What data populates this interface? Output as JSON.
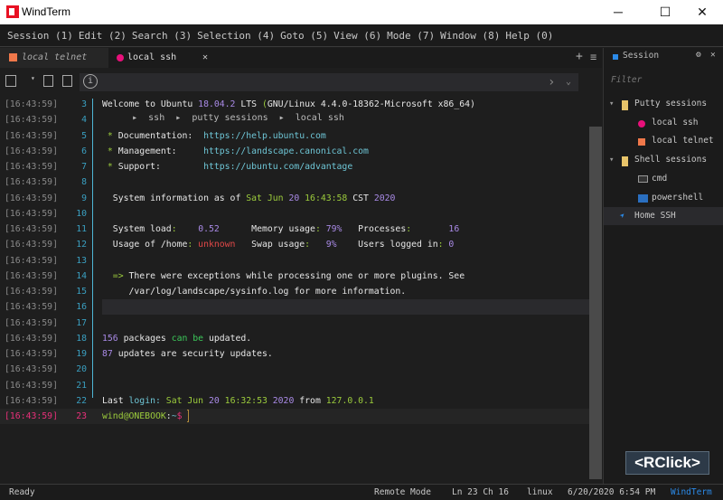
{
  "window": {
    "title": "WindTerm",
    "minimize": "─",
    "maximize": "☐",
    "close": "✕"
  },
  "menu": [
    "Session (1)",
    "Edit (2)",
    "Search (3)",
    "Selection (4)",
    "Goto (5)",
    "View (6)",
    "Mode (7)",
    "Window (8)",
    "Help (0)"
  ],
  "tabs": [
    {
      "label": "local telnet",
      "color": "#f0784a"
    },
    {
      "label": "local ssh",
      "color": "#e8107a"
    }
  ],
  "tab_close": "✕",
  "tab_add": "+",
  "tab_menu": "≡",
  "breadcrumb": "▸  ssh  ▸  putty sessions  ▸  local ssh",
  "colors": {
    "w": "#e6e6e6",
    "p": "#a98ae6",
    "g": "#9ccc3c",
    "c": "#6ec5d5",
    "r": "#e04848",
    "G": "#3cc85a",
    "d": "#b0b0b0",
    "pink": "#e8307a"
  },
  "terminal": {
    "timestamp": "[16:43:59]",
    "lines": [
      {
        "n": "3",
        "s": [
          [
            "Welcome to Ubuntu ",
            "w"
          ],
          [
            "18.04.2",
            "p"
          ],
          [
            " LTS ",
            "w"
          ],
          [
            "(",
            "g"
          ],
          [
            "GNU/Linux 4.4.0-18362-Microsoft x86_64)",
            "w"
          ]
        ]
      },
      {
        "n": "4",
        "s": []
      },
      {
        "n": "5",
        "s": [
          [
            " * ",
            "g"
          ],
          [
            "Documentation:  ",
            "w"
          ],
          [
            "https://help.ubuntu.com",
            "c"
          ]
        ]
      },
      {
        "n": "6",
        "s": [
          [
            " * ",
            "g"
          ],
          [
            "Management:     ",
            "w"
          ],
          [
            "https://landscape.canonical.com",
            "c"
          ]
        ]
      },
      {
        "n": "7",
        "s": [
          [
            " * ",
            "g"
          ],
          [
            "Support:        ",
            "w"
          ],
          [
            "https://ubuntu.com/advantage",
            "c"
          ]
        ]
      },
      {
        "n": "8",
        "s": []
      },
      {
        "n": "9",
        "s": [
          [
            "  System information as of ",
            "w"
          ],
          [
            "Sat Jun ",
            "g"
          ],
          [
            "20",
            "p"
          ],
          [
            " 16:43:58 ",
            "g"
          ],
          [
            "CST ",
            "w"
          ],
          [
            "2020",
            "p"
          ]
        ]
      },
      {
        "n": "10",
        "s": []
      },
      {
        "n": "11",
        "s": [
          [
            "  System load",
            "w"
          ],
          [
            ":    ",
            "g"
          ],
          [
            "0.52",
            "p"
          ],
          [
            "      Memory usage",
            "w"
          ],
          [
            ": ",
            "g"
          ],
          [
            "79%",
            "p"
          ],
          [
            "   Processes",
            "w"
          ],
          [
            ":       ",
            "g"
          ],
          [
            "16",
            "p"
          ]
        ]
      },
      {
        "n": "12",
        "s": [
          [
            "  Usage of /home",
            "w"
          ],
          [
            ": ",
            "g"
          ],
          [
            "unknown",
            "r"
          ],
          [
            "   Swap usage",
            "w"
          ],
          [
            ":   ",
            "g"
          ],
          [
            "9%",
            "p"
          ],
          [
            "    Users logged in",
            "w"
          ],
          [
            ": ",
            "g"
          ],
          [
            "0",
            "p"
          ]
        ]
      },
      {
        "n": "13",
        "s": []
      },
      {
        "n": "14",
        "s": [
          [
            "  => ",
            "g"
          ],
          [
            "There were exceptions while processing one or more plugins. See",
            "w"
          ]
        ]
      },
      {
        "n": "15",
        "s": [
          [
            "     /var/log/landscape/sysinfo.log for more information.",
            "w"
          ]
        ]
      },
      {
        "n": "16",
        "s": []
      },
      {
        "n": "17",
        "s": []
      },
      {
        "n": "18",
        "s": [
          [
            "156",
            "p"
          ],
          [
            " packages ",
            "w"
          ],
          [
            "can be",
            "G"
          ],
          [
            " updated.",
            "w"
          ]
        ]
      },
      {
        "n": "19",
        "s": [
          [
            "87",
            "p"
          ],
          [
            " updates are security updates.",
            "w"
          ]
        ]
      },
      {
        "n": "20",
        "s": []
      },
      {
        "n": "21",
        "s": []
      },
      {
        "n": "22",
        "s": [
          [
            "Last ",
            "w"
          ],
          [
            "login: ",
            "c"
          ],
          [
            "Sat Jun ",
            "g"
          ],
          [
            "20",
            "p"
          ],
          [
            " 16:32:53 ",
            "g"
          ],
          [
            "2020",
            "p"
          ],
          [
            " from ",
            "w"
          ],
          [
            "127.0.0.1",
            "g"
          ]
        ]
      },
      {
        "n": "23",
        "s": [
          [
            "wind@ONEBOOK",
            "g"
          ],
          [
            ":",
            "w"
          ],
          [
            "~",
            "c"
          ],
          [
            "$",
            "pink"
          ],
          [
            " ",
            "w"
          ]
        ]
      }
    ]
  },
  "sidebar": {
    "title": "Session",
    "filter_placeholder": "Filter",
    "items": [
      {
        "label": "Putty sessions",
        "icon": "folder-icon",
        "level": 0
      },
      {
        "label": "local ssh",
        "icon": "circle-icon",
        "level": 1
      },
      {
        "label": "local telnet",
        "icon": "square-icon",
        "level": 1
      },
      {
        "label": "Shell sessions",
        "icon": "folder-icon",
        "level": 0
      },
      {
        "label": "cmd",
        "icon": "cmd-icon",
        "level": 1
      },
      {
        "label": "powershell",
        "icon": "powershell-icon",
        "level": 1
      },
      {
        "label": "Home SSH",
        "icon": "send-icon",
        "level": 0
      }
    ]
  },
  "status": {
    "ready": "Ready",
    "mode": "Remote Mode",
    "position": "Ln 23 Ch 16",
    "os": "linux",
    "datetime": "6/20/2020 6:54 PM",
    "app": "WindTerm"
  },
  "overlay": "<RClick>"
}
